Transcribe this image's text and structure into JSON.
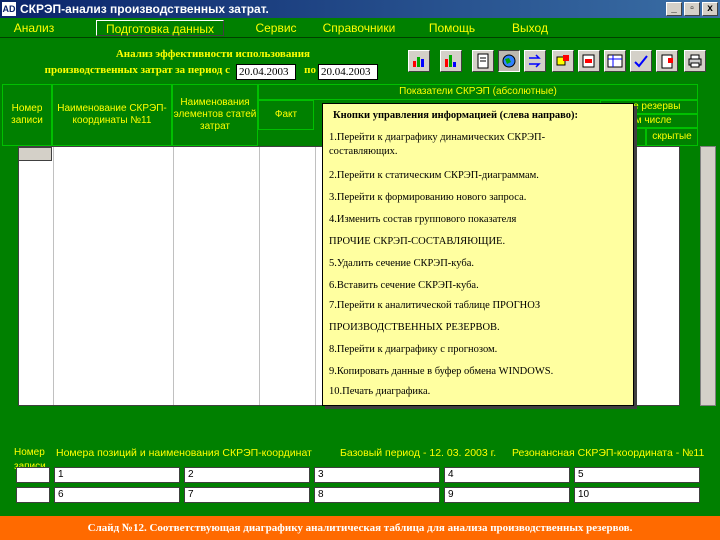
{
  "window": {
    "icon_text": "AD",
    "title": "СКРЭП-анализ производственных затрат.",
    "minimize": "_",
    "maximize": "▫",
    "close": "x"
  },
  "menu": {
    "items": [
      "Анализ",
      "Подготовка данных",
      "Сервис",
      "Справочники",
      "Помощь",
      "Выход"
    ]
  },
  "period": {
    "label_line1": "Анализ эффективности использования",
    "label_line2": "производственных затрат за период с",
    "from": "20.04.2003",
    "to_label": "по",
    "to": "20.04.2003"
  },
  "toolbar": {
    "icons": [
      "bar-chart-icon",
      "bar-chart-2-icon",
      "file-icon",
      "globe-icon",
      "arrows-icon",
      "cube-delete-icon",
      "cube-insert-icon",
      "table-icon",
      "chart-check-icon",
      "clipboard-icon",
      "printer-icon"
    ]
  },
  "table": {
    "col_num": "Номер записи",
    "col_name": "Наименование СКРЭП-координаты №11",
    "col_elements": "Наименования элементов статей затрат",
    "col_group": "Показатели СКРЭП (абсолютные)",
    "col_fact": "Факт",
    "col_reserves": "...ые резервы",
    "col_incl": "...м числе",
    "col_p": "...ые",
    "col_hidden": "скрытые"
  },
  "popup": {
    "title": "Кнопки управления информацией (слева направо):",
    "lines": [
      "1.Перейти к диаграфику динамических СКРЭП-",
      "составляющих.",
      "2.Перейти к статическим СКРЭП-диаграммам.",
      "3.Перейти к формированию нового запроса.",
      "4.Изменить состав группового показателя",
      "ПРОЧИЕ СКРЭП-СОСТАВЛЯЮЩИЕ.",
      "5.Удалить сечение СКРЭП-куба.",
      "6.Вставить сечение СКРЭП-куба.",
      "7.Перейти к аналитической таблице ПРОГНОЗ",
      "ПРОИЗВОДСТВЕННЫХ РЕЗЕРВОВ.",
      "8.Перейти к диаграфику с прогнозом.",
      "9.Копировать данные в буфер обмена WINDOWS.",
      "10.Печать диаграфика."
    ]
  },
  "bottom": {
    "num_label": "Номер записи",
    "positions_label": "Номера позиций и наименования СКРЭП-координат",
    "base_period": "Базовый период - 12. 03. 2003 г.",
    "resonant": "Резонансная СКРЭП-координата - №11",
    "cells": [
      "1",
      "2",
      "3",
      "4",
      "5",
      "6",
      "7",
      "8",
      "9",
      "10"
    ]
  },
  "caption": "Слайд №12. Соответствующая диаграфику аналитическая таблица для анализа производственных резервов."
}
